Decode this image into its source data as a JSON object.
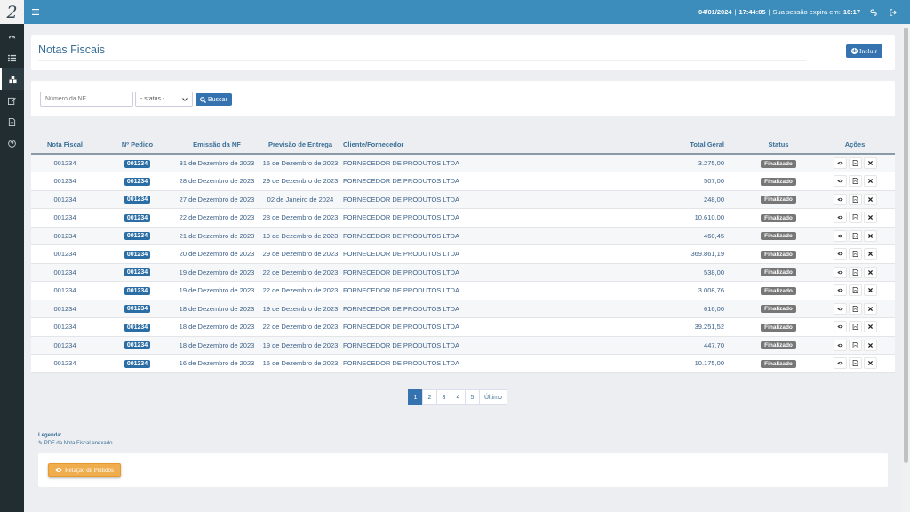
{
  "app": {
    "logo_text": "2"
  },
  "topbar": {
    "date": "04/01/2024",
    "time": "17:44:05",
    "session_label": "Sua sessão expira em:",
    "session_time": "16:17"
  },
  "header": {
    "title": "Notas Fiscais",
    "add_label": "Incluir"
  },
  "filters": {
    "nf_placeholder": "Número da NF",
    "status_value": "- status -",
    "search_label": "Buscar"
  },
  "table": {
    "columns": {
      "nota": "Nota Fiscal",
      "pedido": "Nº Pedido",
      "emissao": "Emissão da NF",
      "previsao": "Previsão de Entrega",
      "fornecedor": "Cliente/Fornecedor",
      "total": "Total Geral",
      "status": "Status",
      "acoes": "Ações"
    },
    "rows": [
      {
        "nota": "001234",
        "pedido": "001234",
        "emissao": "31 de Dezembro de 2023",
        "previsao": "15 de Dezembro de 2023",
        "fornecedor": "FORNECEDOR DE PRODUTOS LTDA",
        "total": "3.275,00",
        "status": "Finalizado"
      },
      {
        "nota": "001234",
        "pedido": "001234",
        "emissao": "28 de Dezembro de 2023",
        "previsao": "29 de Dezembro de 2023",
        "fornecedor": "FORNECEDOR DE PRODUTOS LTDA",
        "total": "507,00",
        "status": "Finalizado"
      },
      {
        "nota": "001234",
        "pedido": "001234",
        "emissao": "27 de Dezembro de 2023",
        "previsao": "02 de Janeiro de 2024",
        "fornecedor": "FORNECEDOR DE PRODUTOS LTDA",
        "total": "248,00",
        "status": "Finalizado"
      },
      {
        "nota": "001234",
        "pedido": "001234",
        "emissao": "22 de Dezembro de 2023",
        "previsao": "28 de Dezembro de 2023",
        "fornecedor": "FORNECEDOR DE PRODUTOS LTDA",
        "total": "10.610,00",
        "status": "Finalizado"
      },
      {
        "nota": "001234",
        "pedido": "001234",
        "emissao": "21 de Dezembro de 2023",
        "previsao": "19 de Dezembro de 2023",
        "fornecedor": "FORNECEDOR DE PRODUTOS LTDA",
        "total": "460,45",
        "status": "Finalizado"
      },
      {
        "nota": "001234",
        "pedido": "001234",
        "emissao": "20 de Dezembro de 2023",
        "previsao": "29 de Dezembro de 2023",
        "fornecedor": "FORNECEDOR DE PRODUTOS LTDA",
        "total": "369.861,19",
        "status": "Finalizado"
      },
      {
        "nota": "001234",
        "pedido": "001234",
        "emissao": "19 de Dezembro de 2023",
        "previsao": "22 de Dezembro de 2023",
        "fornecedor": "FORNECEDOR DE PRODUTOS LTDA",
        "total": "538,00",
        "status": "Finalizado"
      },
      {
        "nota": "001234",
        "pedido": "001234",
        "emissao": "19 de Dezembro de 2023",
        "previsao": "22 de Dezembro de 2023",
        "fornecedor": "FORNECEDOR DE PRODUTOS LTDA",
        "total": "3.008,76",
        "status": "Finalizado"
      },
      {
        "nota": "001234",
        "pedido": "001234",
        "emissao": "18 de Dezembro de 2023",
        "previsao": "19 de Dezembro de 2023",
        "fornecedor": "FORNECEDOR DE PRODUTOS LTDA",
        "total": "616,00",
        "status": "Finalizado"
      },
      {
        "nota": "001234",
        "pedido": "001234",
        "emissao": "18 de Dezembro de 2023",
        "previsao": "22 de Dezembro de 2023",
        "fornecedor": "FORNECEDOR DE PRODUTOS LTDA",
        "total": "39.251,52",
        "status": "Finalizado"
      },
      {
        "nota": "001234",
        "pedido": "001234",
        "emissao": "18 de Dezembro de 2023",
        "previsao": "19 de Dezembro de 2023",
        "fornecedor": "FORNECEDOR DE PRODUTOS LTDA",
        "total": "447,70",
        "status": "Finalizado"
      },
      {
        "nota": "001234",
        "pedido": "001234",
        "emissao": "16 de Dezembro de 2023",
        "previsao": "15 de Dezembro de 2023",
        "fornecedor": "FORNECEDOR DE PRODUTOS LTDA",
        "total": "10.175,00",
        "status": "Finalizado"
      }
    ]
  },
  "pagination": {
    "pages": [
      "1",
      "2",
      "3",
      "4",
      "5"
    ],
    "last_label": "Último",
    "active": "1"
  },
  "legend": {
    "title": "Legenda:",
    "pdf_item": "PDF da Nota Fiscal anexado",
    "orders_button": "Relação de Pedidos"
  },
  "colors": {
    "topbar": "#3c8dbc",
    "sidebar": "#222d32",
    "primary": "#3473b0",
    "warning": "#f0ad4e",
    "status_badge": "#777777"
  },
  "icons": {
    "sidebar": [
      "dashboard-icon",
      "list-icon",
      "cubes-icon",
      "edit-icon",
      "file-icon",
      "help-icon"
    ],
    "row_actions": [
      "eye-icon",
      "pdf-icon",
      "close-icon"
    ]
  }
}
